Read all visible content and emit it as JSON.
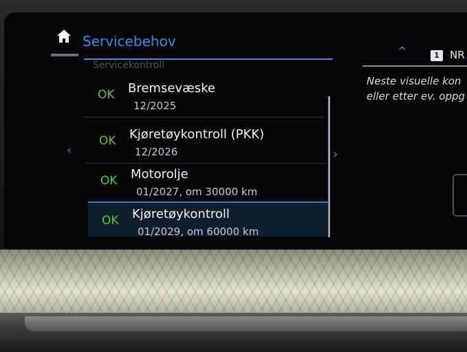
{
  "header": {
    "home_icon": "home-icon",
    "title": "Servicebehov"
  },
  "list": {
    "partial_top_item": "Servicekontroll",
    "items": [
      {
        "status": "OK",
        "title": "Bremsevæske",
        "subtitle": "12/2025"
      },
      {
        "status": "OK",
        "title": "Kjøretøykontroll (PKK)",
        "subtitle": "12/2026"
      },
      {
        "status": "OK",
        "title": "Motorolje",
        "subtitle": "01/2027, om 30000 km"
      },
      {
        "status": "OK",
        "title": "Kjøretøykontroll",
        "subtitle": "01/2029, om 60000 km"
      }
    ],
    "selected_index": 3
  },
  "navigation": {
    "left_arrow": "‹",
    "right_arrow": "›",
    "up_arrow": "^"
  },
  "right_panel": {
    "badge": "1",
    "badge_label": "NR",
    "text_line1": "Neste visuelle kon",
    "text_line2": "eller etter ev. oppg"
  },
  "colors": {
    "accent": "#3a8fe0",
    "ok": "#58c93a",
    "background": "#050608"
  }
}
